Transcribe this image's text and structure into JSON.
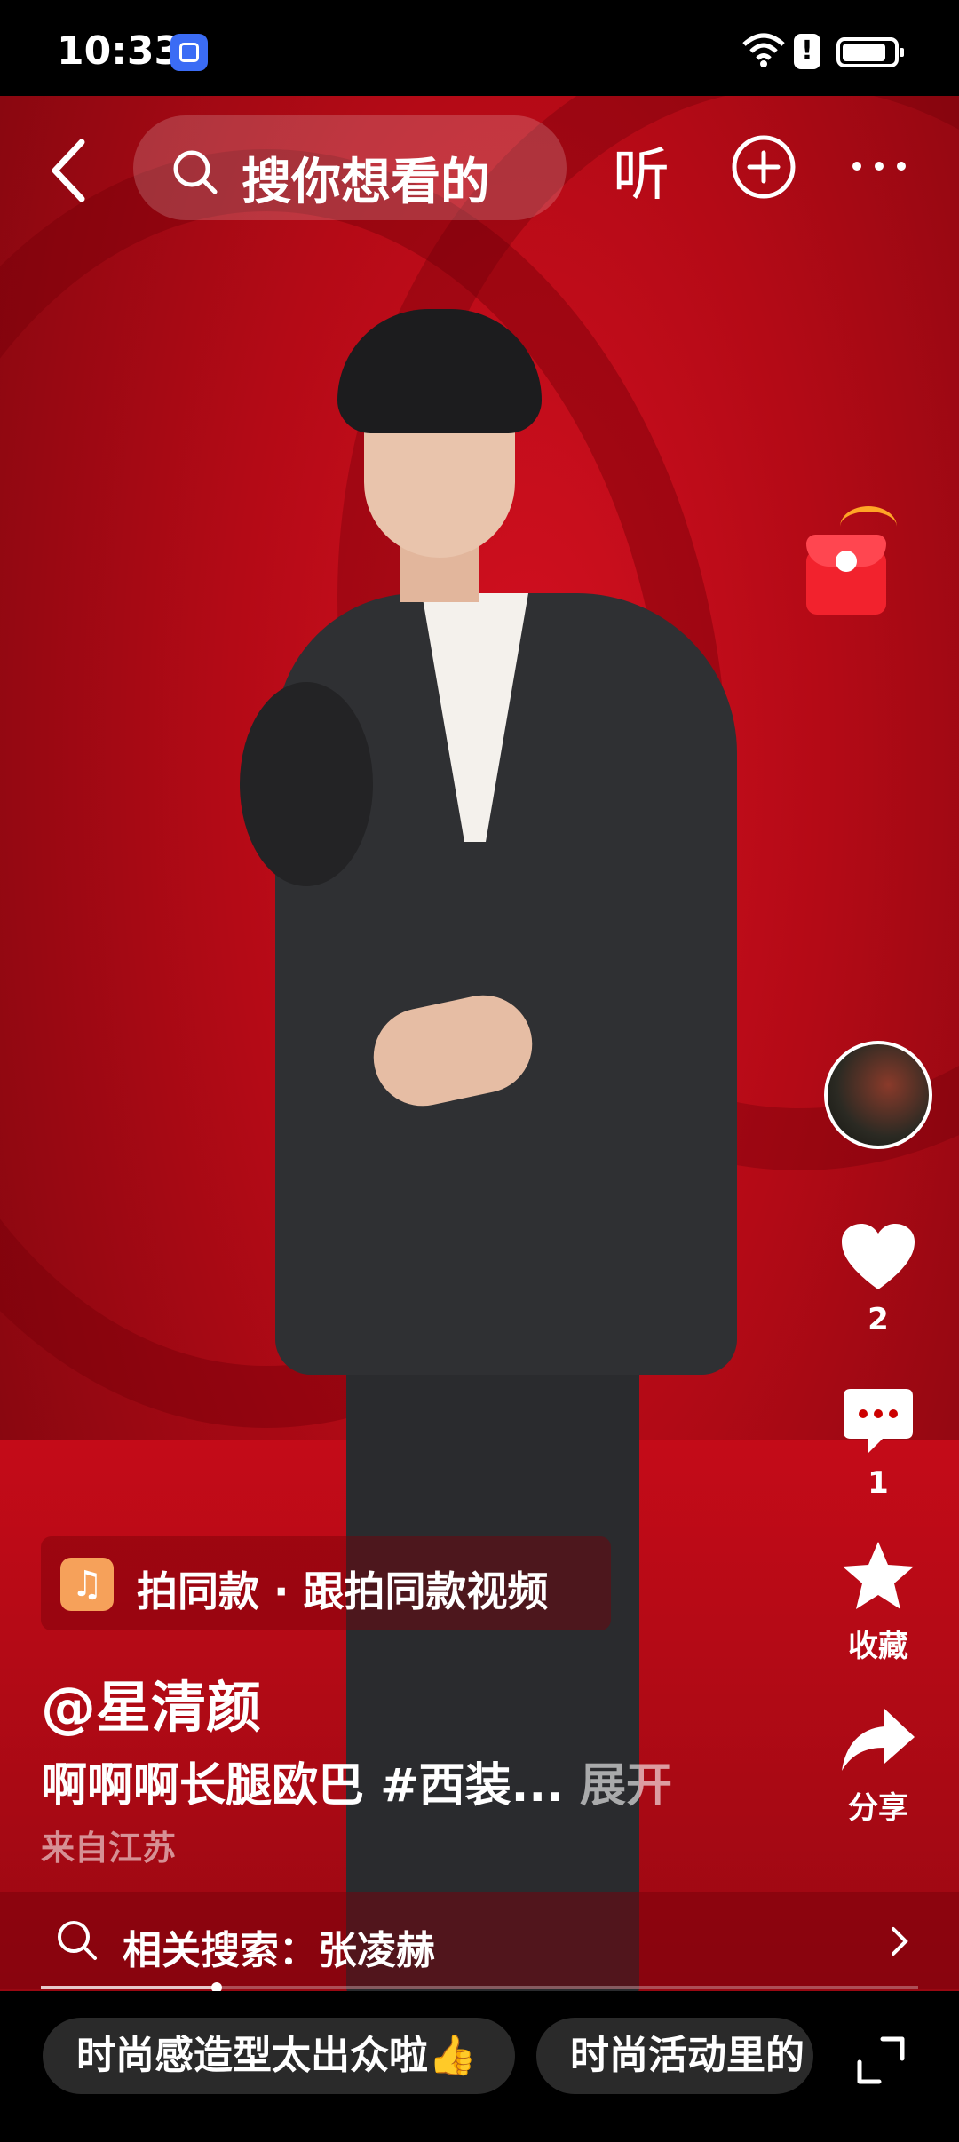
{
  "status_bar": {
    "time": "10:33"
  },
  "top_nav": {
    "search_placeholder": "搜你想看的",
    "listen_label": "听"
  },
  "right_rail": {
    "likes": {
      "count": "2"
    },
    "comments": {
      "count": "1"
    },
    "favorite": {
      "label": "收藏"
    },
    "share": {
      "label": "分享"
    }
  },
  "same_clip": {
    "label": "拍同款 · 跟拍同款视频"
  },
  "post": {
    "author": "@星清颜",
    "caption": "啊啊啊长腿欧巴 #西装...",
    "expand": "展开",
    "location": "来自江苏"
  },
  "related_search": {
    "label": "相关搜索：张凌赫"
  },
  "playback": {
    "progress": 0.2
  },
  "bottom_chips": [
    "时尚感造型太出众啦👍",
    "时尚活动里的"
  ],
  "colors": {
    "accent_red": "#d41020",
    "packet_red": "#f2222d"
  }
}
